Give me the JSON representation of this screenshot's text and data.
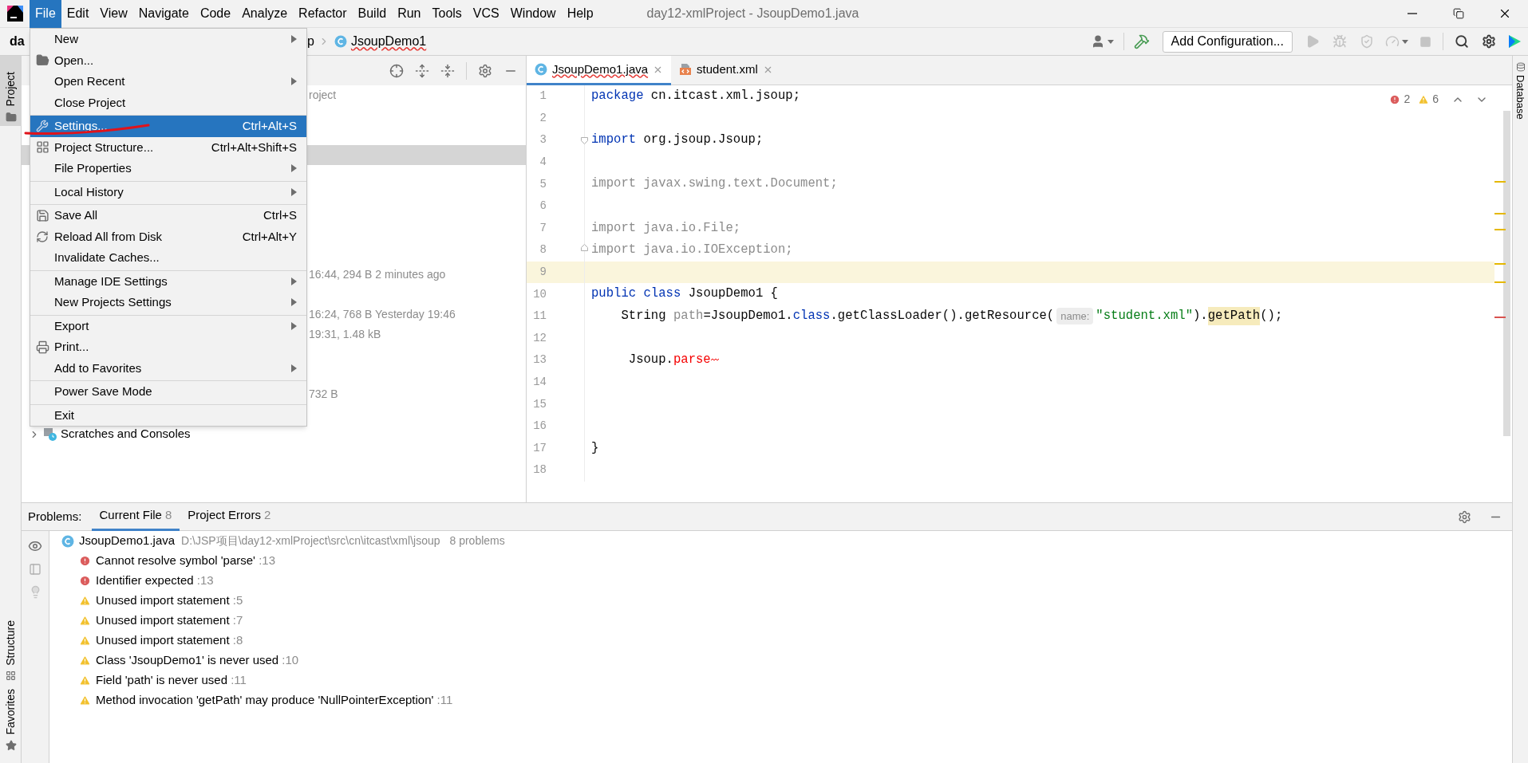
{
  "menu_bar": {
    "items": [
      {
        "label": "File",
        "selected": true
      },
      {
        "label": "Edit",
        "selected": false
      },
      {
        "label": "View",
        "selected": false
      },
      {
        "label": "Navigate",
        "selected": false
      },
      {
        "label": "Code",
        "selected": false
      },
      {
        "label": "Analyze",
        "selected": false
      },
      {
        "label": "Refactor",
        "selected": false
      },
      {
        "label": "Build",
        "selected": false
      },
      {
        "label": "Run",
        "selected": false
      },
      {
        "label": "Tools",
        "selected": false
      },
      {
        "label": "VCS",
        "selected": false
      },
      {
        "label": "Window",
        "selected": false
      },
      {
        "label": "Help",
        "selected": false
      }
    ],
    "title": "day12-xmlProject - JsoupDemo1.java"
  },
  "nav_bar": {
    "root": "da",
    "crumbs": [
      {
        "text": "p",
        "kind": "folder"
      },
      {
        "text": "JsoupDemo1",
        "kind": "class"
      }
    ],
    "run_config": "Add Configuration..."
  },
  "left_strip": [
    {
      "label": "Project",
      "selected": true
    },
    {
      "label": "Structure",
      "selected": false
    },
    {
      "label": "Favorites",
      "selected": false
    }
  ],
  "right_strip": {
    "label": "Database"
  },
  "project_panel": {
    "rows": [
      {
        "kind": "detail",
        "text": "roject",
        "selected": false
      },
      {
        "kind": "hidden",
        "selected": false
      },
      {
        "kind": "hidden",
        "selected": false
      },
      {
        "kind": "hidden",
        "selected": true
      },
      {
        "kind": "hidden",
        "selected": false
      },
      {
        "kind": "hidden",
        "selected": false
      },
      {
        "kind": "hidden",
        "selected": false
      },
      {
        "kind": "hidden",
        "selected": false
      },
      {
        "kind": "hidden",
        "selected": false
      },
      {
        "kind": "detail",
        "text": "16:44, 294 B 2 minutes ago",
        "selected": false
      },
      {
        "kind": "hidden",
        "selected": false
      },
      {
        "kind": "detail",
        "text": "16:24, 768 B Yesterday 19:46",
        "selected": false
      },
      {
        "kind": "detail",
        "text": "19:31, 1.48 kB",
        "selected": false
      },
      {
        "kind": "hidden",
        "selected": false
      },
      {
        "kind": "hidden",
        "selected": false
      },
      {
        "kind": "detail",
        "text": "732 B",
        "selected": false
      },
      {
        "kind": "hidden",
        "selected": false
      },
      {
        "kind": "node",
        "text": "Scratches and Consoles",
        "selected": false
      }
    ]
  },
  "editor": {
    "tabs": [
      {
        "label": "JsoupDemo1.java",
        "kind": "java",
        "selected": true
      },
      {
        "label": "student.xml",
        "kind": "xml",
        "selected": false
      }
    ],
    "error_count": "2",
    "warning_count": "6",
    "lines": [
      {
        "number": "1",
        "current": false,
        "tokens": [
          {
            "text": "package",
            "kind": "keyword"
          },
          {
            "text": " cn.itcast.xml.jsoup;",
            "kind": "plain"
          }
        ]
      },
      {
        "number": "2",
        "current": false
      },
      {
        "number": "3",
        "current": false,
        "kind": "fold_start",
        "tokens": [
          {
            "text": "import",
            "kind": "keyword"
          },
          {
            "text": " org.jsoup.Jsoup;",
            "kind": "plain"
          }
        ]
      },
      {
        "number": "4",
        "current": false
      },
      {
        "number": "5",
        "current": false,
        "tokens": [
          {
            "text": "import javax.swing.text.Document;",
            "kind": "unused"
          }
        ]
      },
      {
        "number": "6",
        "current": false
      },
      {
        "number": "7",
        "current": false,
        "tokens": [
          {
            "text": "import java.io.File;",
            "kind": "unused"
          }
        ]
      },
      {
        "number": "8",
        "current": false,
        "kind": "fold_end",
        "tokens": [
          {
            "text": "import java.io.IOException;",
            "kind": "unused"
          }
        ]
      },
      {
        "number": "9",
        "current": true
      },
      {
        "number": "10",
        "current": false,
        "tokens": [
          {
            "text": "public",
            "kind": "keyword"
          },
          {
            "text": " class",
            "kind": "keyword"
          },
          {
            "text": " JsoupDemo1 {",
            "kind": "plain"
          }
        ]
      },
      {
        "number": "11",
        "current": false,
        "tokens": [
          {
            "text": "    String ",
            "kind": "plain"
          },
          {
            "text": "path",
            "kind": "unused"
          },
          {
            "text": "=JsoupDemo1.",
            "kind": "plain"
          },
          {
            "text": "class",
            "kind": "keyword"
          },
          {
            "text": ".getClassLoader().getResource(",
            "kind": "plain"
          },
          {
            "text": "name:",
            "kind": "hint"
          },
          {
            "text": "\"student.xml\"",
            "kind": "string"
          },
          {
            "text": ").",
            "kind": "plain"
          },
          {
            "text": "getPath",
            "kind": "highlight"
          },
          {
            "text": "();",
            "kind": "plain"
          }
        ]
      },
      {
        "number": "12",
        "current": false
      },
      {
        "number": "13",
        "current": false,
        "tokens": [
          {
            "text": "     Jsoup.",
            "kind": "plain"
          },
          {
            "text": "parse",
            "kind": "error"
          }
        ]
      },
      {
        "number": "14",
        "current": false
      },
      {
        "number": "15",
        "current": false
      },
      {
        "number": "16",
        "current": false
      },
      {
        "number": "17",
        "current": false,
        "tokens": [
          {
            "text": "}",
            "kind": "plain"
          }
        ]
      },
      {
        "number": "18",
        "current": false
      }
    ]
  },
  "file_menu": {
    "items": [
      {
        "label": "New",
        "submenu": true,
        "selected": false
      },
      {
        "label": "Open...",
        "submenu": false,
        "selected": false
      },
      {
        "label": "Open Recent",
        "submenu": true,
        "selected": false
      },
      {
        "label": "Close Project",
        "submenu": false,
        "selected": false,
        "separator_after": true
      },
      {
        "label": "Settings...",
        "shortcut": "Ctrl+Alt+S",
        "submenu": false,
        "selected": true
      },
      {
        "label": "Project Structure...",
        "shortcut": "Ctrl+Alt+Shift+S",
        "submenu": false,
        "selected": false
      },
      {
        "label": "File Properties",
        "submenu": true,
        "selected": false,
        "separator_after": true
      },
      {
        "label": "Local History",
        "submenu": true,
        "selected": false,
        "separator_after": true
      },
      {
        "label": "Save All",
        "shortcut": "Ctrl+S",
        "submenu": false,
        "selected": false
      },
      {
        "label": "Reload All from Disk",
        "shortcut": "Ctrl+Alt+Y",
        "submenu": false,
        "selected": false
      },
      {
        "label": "Invalidate Caches...",
        "submenu": false,
        "selected": false,
        "separator_after": true
      },
      {
        "label": "Manage IDE Settings",
        "submenu": true,
        "selected": false
      },
      {
        "label": "New Projects Settings",
        "submenu": true,
        "selected": false,
        "separator_after": true
      },
      {
        "label": "Export",
        "submenu": true,
        "selected": false
      },
      {
        "label": "Print...",
        "submenu": false,
        "selected": false
      },
      {
        "label": "Add to Favorites",
        "submenu": true,
        "selected": false,
        "separator_after": true
      },
      {
        "label": "Power Save Mode",
        "submenu": false,
        "selected": false,
        "separator_after": true
      },
      {
        "label": "Exit",
        "submenu": false,
        "selected": false
      }
    ]
  },
  "problems": {
    "label": "Problems:",
    "tabs": [
      {
        "label": "Current File",
        "count": "8",
        "selected": true
      },
      {
        "label": "Project Errors",
        "count": "2",
        "selected": false
      }
    ],
    "file": {
      "name": "JsoupDemo1.java",
      "path": "D:\\JSP项目\\day12-xmlProject\\src\\cn\\itcast\\xml\\jsoup",
      "summary": "8 problems"
    },
    "items": [
      {
        "kind": "error",
        "text": "Cannot resolve symbol 'parse'",
        "location": ":13"
      },
      {
        "kind": "error",
        "text": "Identifier expected",
        "location": ":13"
      },
      {
        "kind": "warning",
        "text": "Unused import statement",
        "location": ":5"
      },
      {
        "kind": "warning",
        "text": "Unused import statement",
        "location": ":7"
      },
      {
        "kind": "warning",
        "text": "Unused import statement",
        "location": ":8"
      },
      {
        "kind": "warning",
        "text": "Class 'JsoupDemo1' is never used",
        "location": ":10"
      },
      {
        "kind": "warning",
        "text": "Field 'path' is never used",
        "location": ":11"
      },
      {
        "kind": "warning",
        "text": "Method invocation 'getPath' may produce 'NullPointerException'",
        "location": ":11"
      }
    ]
  }
}
